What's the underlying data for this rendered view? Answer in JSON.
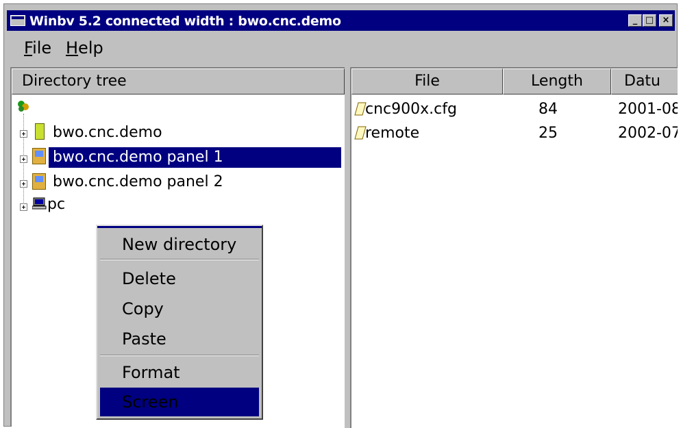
{
  "window": {
    "title": "Winbv 5.2 connected width : bwo.cnc.demo"
  },
  "title_buttons": {
    "minimize": "_",
    "maximize": "□",
    "close": "×"
  },
  "menu": {
    "file": "ile",
    "file_mnemonic": "F",
    "help": "elp",
    "help_mnemonic": "H"
  },
  "tree": {
    "header": "Directory tree",
    "items": [
      {
        "label": "bwo.cnc.demo",
        "icon": "device-icon"
      },
      {
        "label": "bwo.cnc.demo panel 1",
        "icon": "panel-icon",
        "selected": true
      },
      {
        "label": "bwo.cnc.demo panel 2",
        "icon": "panel-icon"
      },
      {
        "label": "pc",
        "icon": "computer-icon"
      }
    ]
  },
  "files": {
    "columns": [
      "File",
      "Length",
      "Datu"
    ],
    "rows": [
      {
        "name": "cnc900x.cfg",
        "length": "84",
        "date": "2001-08"
      },
      {
        "name": "remote",
        "length": "25",
        "date": "2002-07"
      }
    ]
  },
  "context_menu": {
    "items": [
      "New directory",
      "Delete",
      "Copy",
      "Paste",
      "Format",
      "Screen"
    ],
    "highlighted": "Screen"
  }
}
